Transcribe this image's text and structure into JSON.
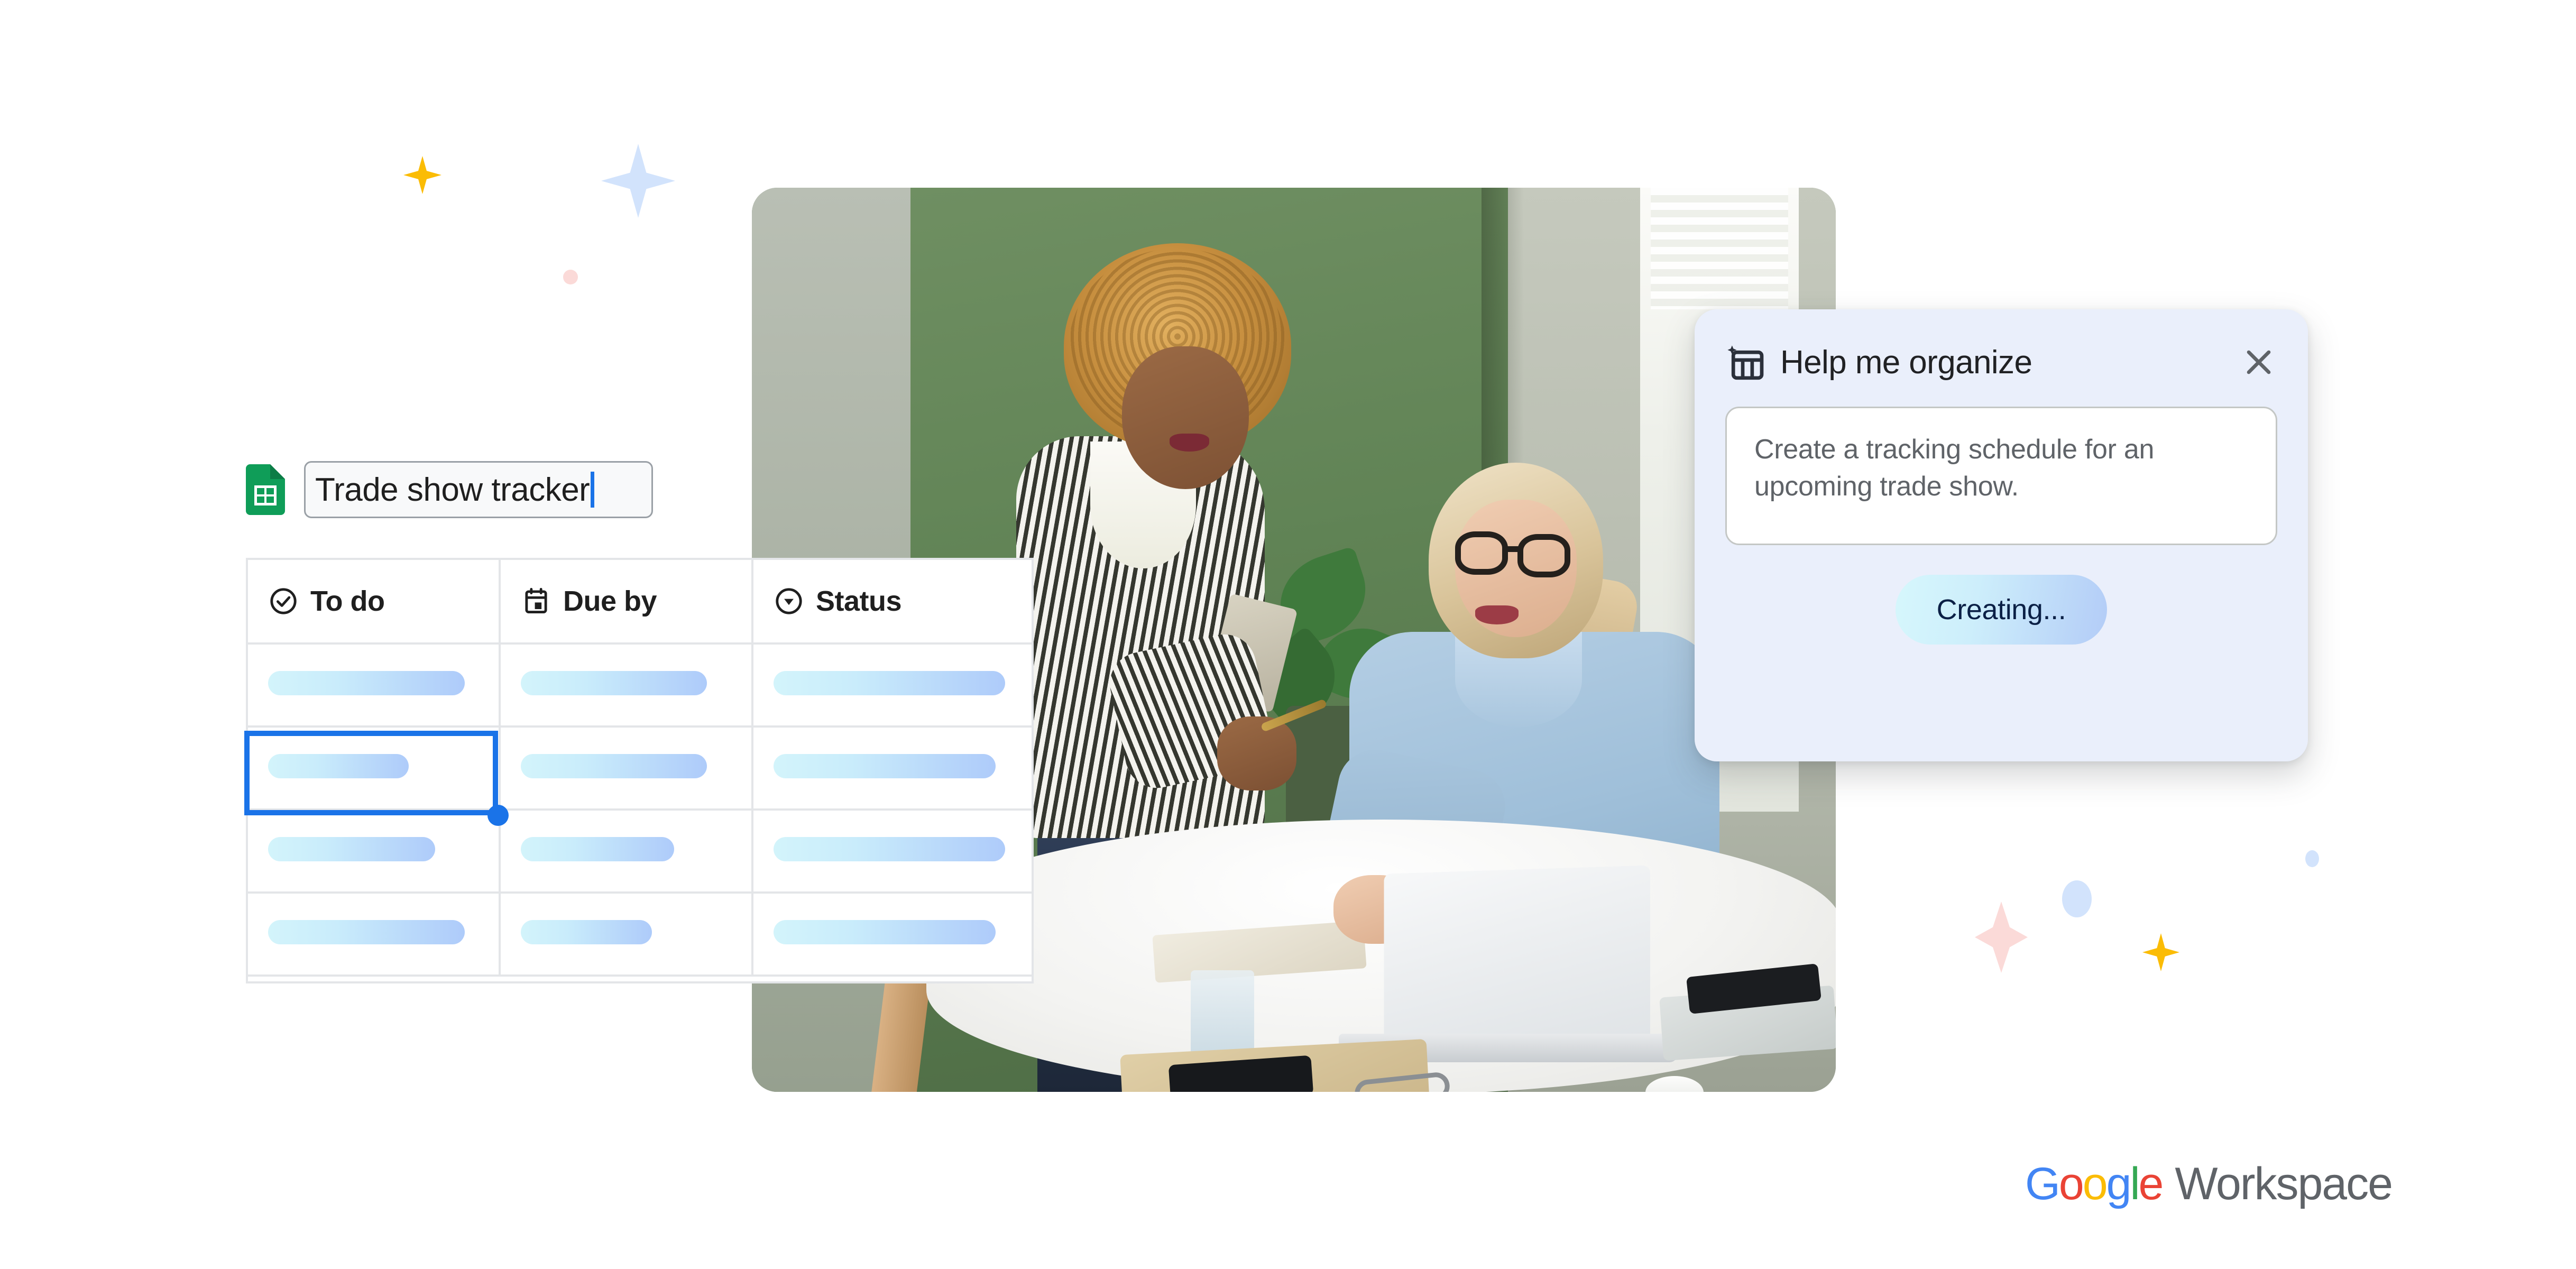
{
  "document": {
    "app_icon": "google-sheets-icon",
    "title_value": "Trade show tracker",
    "title_caret": ""
  },
  "table": {
    "columns": [
      {
        "label": "To do",
        "icon": "check-circle-icon"
      },
      {
        "label": "Due by",
        "icon": "calendar-icon"
      },
      {
        "label": "Status",
        "icon": "dropdown-circle-icon"
      }
    ],
    "rows": [
      {
        "cells": [
          "",
          "",
          ""
        ]
      },
      {
        "cells": [
          "",
          "",
          ""
        ]
      },
      {
        "cells": [
          "",
          "",
          ""
        ]
      },
      {
        "cells": [
          "",
          "",
          ""
        ]
      }
    ],
    "selected_cell": {
      "row": 2,
      "column": 1
    }
  },
  "organize_panel": {
    "icon": "table-sparkle-icon",
    "title": "Help me organize",
    "close_icon": "close-icon",
    "prompt_value": "Create a tracking schedule for an upcoming trade show.",
    "action_label": "Creating..."
  },
  "brand": {
    "google": {
      "g1": "G",
      "o1": "o",
      "o2": "o",
      "g2": "g",
      "l": "l",
      "e": "e"
    },
    "product": "Workspace"
  },
  "colors": {
    "sheets_green": "#0f9d58",
    "selection_blue": "#1a73e8",
    "panel_bg": "#eaeffb",
    "bar_gradient_start": "#d3f4fb",
    "bar_gradient_end": "#aecbfa",
    "sparkle_yellow": "#fbbc05",
    "sparkle_blue": "#d2e3fc",
    "sparkle_pink": "#fbdad8"
  },
  "decorations": [
    {
      "name": "sparkle-star-yellow-top-left",
      "shape": "star4",
      "color": "#fbbc05"
    },
    {
      "name": "sparkle-star-blue-top-left",
      "shape": "star4",
      "color": "#d2e3fc"
    },
    {
      "name": "sparkle-dot-pink-top-left",
      "shape": "dot",
      "color": "#fbdad8"
    },
    {
      "name": "sparkle-diamond-pink-bottom-right",
      "shape": "diamond-soft",
      "color": "#fbdad8"
    },
    {
      "name": "sparkle-dot-blue-bottom-right",
      "shape": "dot",
      "color": "#d2e3fc"
    },
    {
      "name": "sparkle-star-yellow-bottom-right",
      "shape": "star4",
      "color": "#fbbc05"
    },
    {
      "name": "sparkle-dot-blue-far-right",
      "shape": "dot",
      "color": "#d2e3fc"
    }
  ],
  "photo": {
    "alt": "two women collaborating at a round table with a laptop in a green office"
  }
}
